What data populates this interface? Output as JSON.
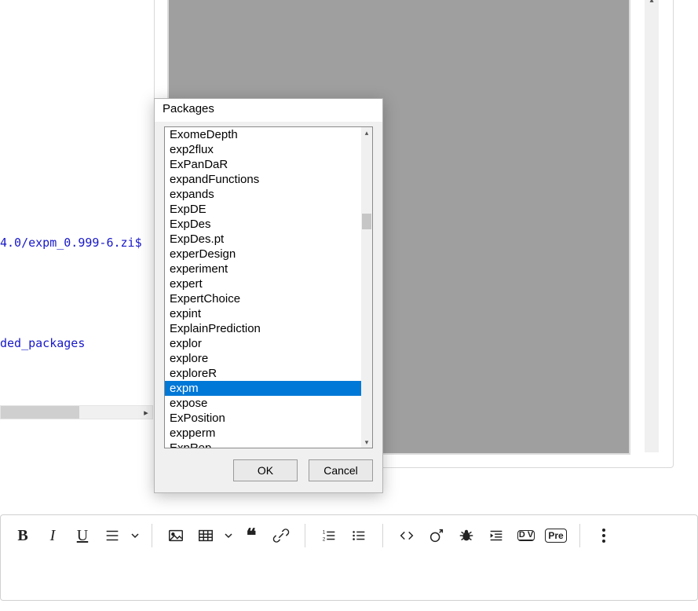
{
  "background": {
    "code_line1": "4.0/expm_0.999-6.zi$",
    "code_line2": "ded_packages"
  },
  "dialog": {
    "title": "Packages",
    "ok_label": "OK",
    "cancel_label": "Cancel",
    "selected_index": 17,
    "items": [
      "ExomeDepth",
      "exp2flux",
      "ExPanDaR",
      "expandFunctions",
      "expands",
      "ExpDE",
      "ExpDes",
      "ExpDes.pt",
      "experDesign",
      "experiment",
      "expert",
      "ExpertChoice",
      "expint",
      "ExplainPrediction",
      "explor",
      "explore",
      "exploreR",
      "expm",
      "expose",
      "ExPosition",
      "expperm",
      "ExpRep"
    ]
  },
  "toolbar": {
    "bold": "B",
    "italic": "I",
    "underline": "U",
    "quote": "❝",
    "pre": "Pre",
    "dv_top": "D V"
  }
}
